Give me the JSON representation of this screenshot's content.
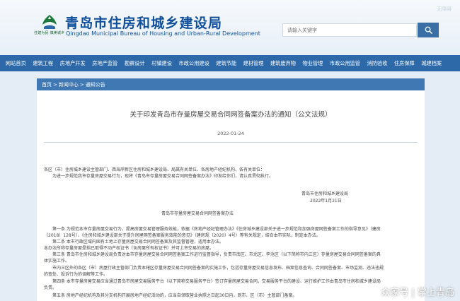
{
  "header": {
    "topbar_link": "无障碍",
    "title_cn": "青岛市住房和城乡建设局",
    "title_en": "Qingdao Municipal Bureau of Housing and Urban-Rural Development",
    "logo_motto": "住建为民 慎美城乡",
    "search_placeholder": "请输入关键字",
    "brand_color": "#0f4f9b"
  },
  "nav": {
    "items": [
      "网站首页",
      "建筑工程",
      "房地产开发",
      "房地产监管",
      "勘察设计",
      "村镇建设",
      "市政公用建设",
      "建筑节能",
      "建材管理",
      "建筑废弃物",
      "物业管理",
      "市政公用监管",
      "消防验收",
      "住房保障",
      "城建档案"
    ],
    "bg_color": "#2d69a8"
  },
  "breadcrumb": {
    "home": "首页",
    "sep1": ">",
    "section": "新闻中心",
    "sep2": ">",
    "current": "通知公告"
  },
  "article": {
    "title": "关于印发青岛市存量房屋交易合同网签备案办法的通知（公文法规）",
    "date": "2022-01-24",
    "lines": [
      "各区（市）住房城乡建设主管部门、西海岸新区住房和城乡建设局、局属有关单位、各房地产经纪机构、各有关单位：",
      "为进一步规范我市存量房屋交易行为，现将《青岛市存量房屋交易合同网签备案办法》印发给你们，请认真贯彻执行。",
      "青岛市住房和城乡建设局",
      "2022年1月21日",
      "青岛市存量房屋交易合同网签备案办法",
      "第一条  为规范本市存量房屋交易行为，提高房屋交易管理服务效能，依据《房地产经纪管理办法》《住房城乡建设部关于进一步规范和加强房屋网签备案工作的指导意见》（建房",
      "（2018）128号）、《住房和城乡建设部关于提升房屋网签备案服务效能的意见》（建房规（2020）4号）等有关规定，结合本市实际，制定本办法。",
      "第二条  本市行政区域内国有土地上存量房屋交易合同网签备案及其监督管理，适用本办法。",
      "本办法所称存量房屋是指已取得不动产权证书（含房屋所有权证书）并可上市交易的房屋。",
      "第三条  青岛市住房和城乡建设局负责对本市存量房屋交易合同网签备案工作进行监督指导，负责市南区、市北区、李沧区（以下简称市内三区）存量房屋交易合同网签备案的具",
      "体实施工作。",
      "市内三区外的各区（市）房屋行政主管部门负责本辖区存量房屋交易合同网签备案的实施工作，包括存量房屋交易信息发布、档案信息查询、合同网签备案、市场监测、违法违规",
      "的查处、投诉行为的调解等工作。",
      "第四条  本市存量房屋交易应当通过青岛市房屋交易服务平台（以下简称交易服务平台）签订存量房屋交易合同。交易服务平台的建设、运行维护工作由青岛市住房和城乡建设局",
      "负责。",
      "第五条  房地产经纪机构及其分支机构开展房地产经纪活动的，应当自领取营业执照之日起30日内，到市、区（市）主管部门备案。"
    ]
  },
  "watermark": "众家号 | 掌上青岛"
}
